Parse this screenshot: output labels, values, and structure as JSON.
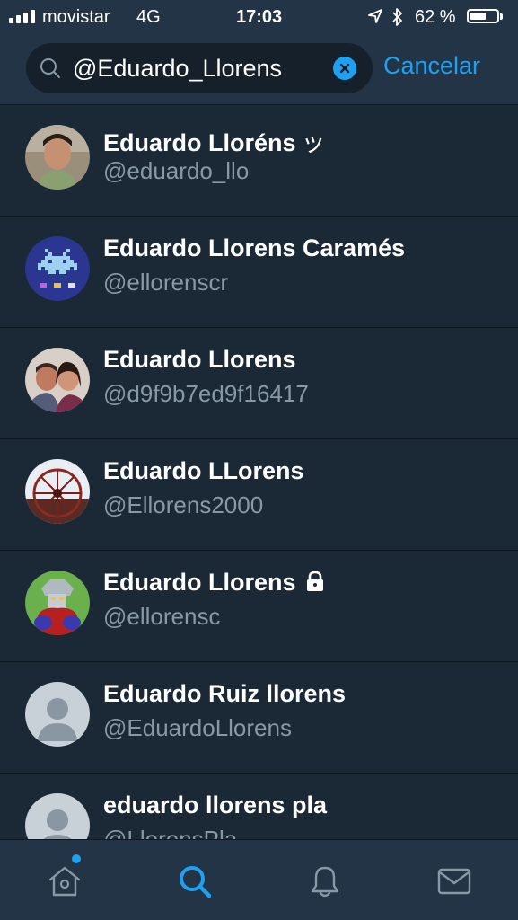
{
  "status_bar": {
    "carrier": "movistar",
    "network": "4G",
    "time": "17:03",
    "battery_percent": "62 %",
    "battery_level": 0.62
  },
  "search": {
    "query": "@Eduardo_Llorens",
    "cancel_label": "Cancelar"
  },
  "results": [
    {
      "name": "Eduardo Lloréns",
      "suffix": "ッ",
      "handle": "@eduardo_llo",
      "avatar": "photo-man",
      "locked": false
    },
    {
      "name": "Eduardo Llorens Caramés",
      "suffix": "",
      "handle": "@ellorenscr",
      "avatar": "space-invader",
      "locked": false
    },
    {
      "name": "Eduardo Llorens",
      "suffix": "",
      "handle": "@d9f9b7ed9f16417",
      "avatar": "photo-couple",
      "locked": false
    },
    {
      "name": "Eduardo LLorens",
      "suffix": "",
      "handle": "@Ellorens2000",
      "avatar": "photo-ferris-wheel",
      "locked": false
    },
    {
      "name": "Eduardo Llorens",
      "suffix": "",
      "handle": "@ellorensc",
      "avatar": "robot-cartoon",
      "locked": true
    },
    {
      "name": "Eduardo Ruiz llorens",
      "suffix": "",
      "handle": "@EduardoLlorens",
      "avatar": "default-profile",
      "locked": false
    },
    {
      "name": "eduardo llorens pla",
      "suffix": "",
      "handle": "@LlorensPla",
      "avatar": "default-profile",
      "locked": false
    }
  ],
  "tab_bar": {
    "tabs": [
      {
        "id": "home",
        "icon": "home-icon",
        "active": false,
        "has_badge": true
      },
      {
        "id": "search",
        "icon": "search-icon",
        "active": true,
        "has_badge": false
      },
      {
        "id": "notifications",
        "icon": "bell-icon",
        "active": false,
        "has_badge": false
      },
      {
        "id": "messages",
        "icon": "envelope-icon",
        "active": false,
        "has_badge": false
      }
    ]
  },
  "colors": {
    "accent": "#1da1f2",
    "background": "#1b2836",
    "header": "#243447",
    "secondary_text": "#8899a6"
  }
}
